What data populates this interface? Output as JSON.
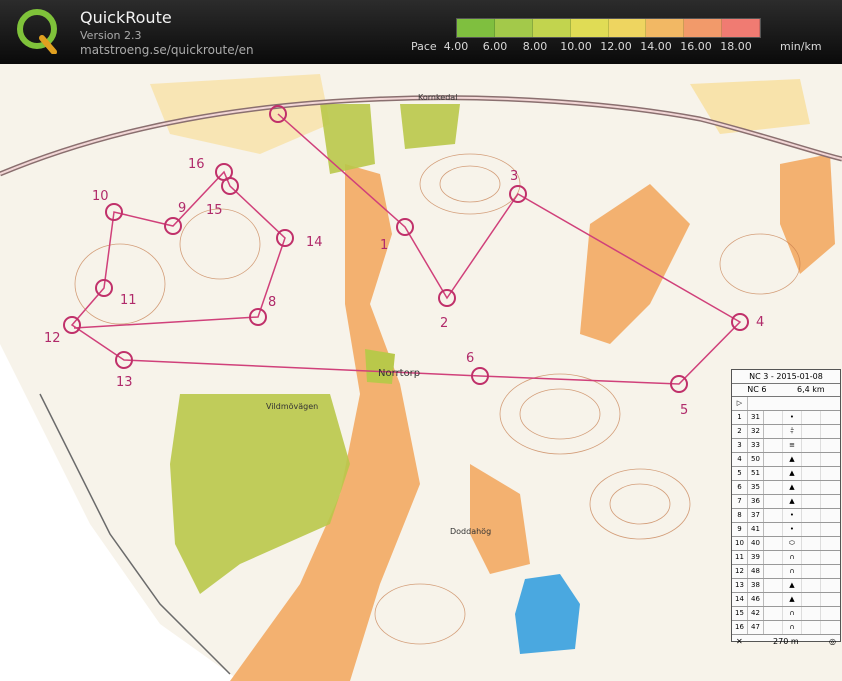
{
  "app": {
    "name": "QuickRoute",
    "version": "Version 2.3",
    "url": "matstroeng.se/quickroute/en"
  },
  "pace": {
    "label": "Pace",
    "ticks": [
      "4.00",
      "6.00",
      "8.00",
      "10.00",
      "12.00",
      "14.00",
      "16.00",
      "18.00"
    ],
    "unit": "min/km",
    "colors": [
      "#7fbf3f",
      "#a3c94a",
      "#c2d44e",
      "#e0dc55",
      "#eed560",
      "#f2b864",
      "#f29a6a",
      "#f07b72"
    ]
  },
  "map": {
    "place_labels": [
      "Kornkedal",
      "Norrtorp",
      "Vildmövägen",
      "Doddahög"
    ],
    "controls": [
      {
        "n": "1"
      },
      {
        "n": "2"
      },
      {
        "n": "3"
      },
      {
        "n": "4"
      },
      {
        "n": "5"
      },
      {
        "n": "6"
      },
      {
        "n": "8"
      },
      {
        "n": "9"
      },
      {
        "n": "10"
      },
      {
        "n": "11"
      },
      {
        "n": "12"
      },
      {
        "n": "13"
      },
      {
        "n": "14"
      },
      {
        "n": "15"
      },
      {
        "n": "16"
      }
    ]
  },
  "description": {
    "header": "NC 3 - 2015-01-08",
    "course": "NC 6",
    "distance": "6,4 km",
    "rows": [
      {
        "num": "1",
        "code": "31",
        "sym": "•"
      },
      {
        "num": "2",
        "code": "32",
        "sym": "⫩"
      },
      {
        "num": "3",
        "code": "33",
        "sym": "≡"
      },
      {
        "num": "4",
        "code": "50",
        "sym": "▲"
      },
      {
        "num": "5",
        "code": "51",
        "sym": "▲"
      },
      {
        "num": "6",
        "code": "35",
        "sym": "▲"
      },
      {
        "num": "7",
        "code": "36",
        "sym": "▲"
      },
      {
        "num": "8",
        "code": "37",
        "sym": "•"
      },
      {
        "num": "9",
        "code": "41",
        "sym": "•"
      },
      {
        "num": "10",
        "code": "40",
        "sym": "⬭"
      },
      {
        "num": "11",
        "code": "39",
        "sym": "∩"
      },
      {
        "num": "12",
        "code": "48",
        "sym": "∩"
      },
      {
        "num": "13",
        "code": "38",
        "sym": "▲"
      },
      {
        "num": "14",
        "code": "46",
        "sym": "▲"
      },
      {
        "num": "15",
        "code": "42",
        "sym": "∩"
      },
      {
        "num": "16",
        "code": "47",
        "sym": "∩"
      }
    ],
    "finish": "270 m"
  }
}
